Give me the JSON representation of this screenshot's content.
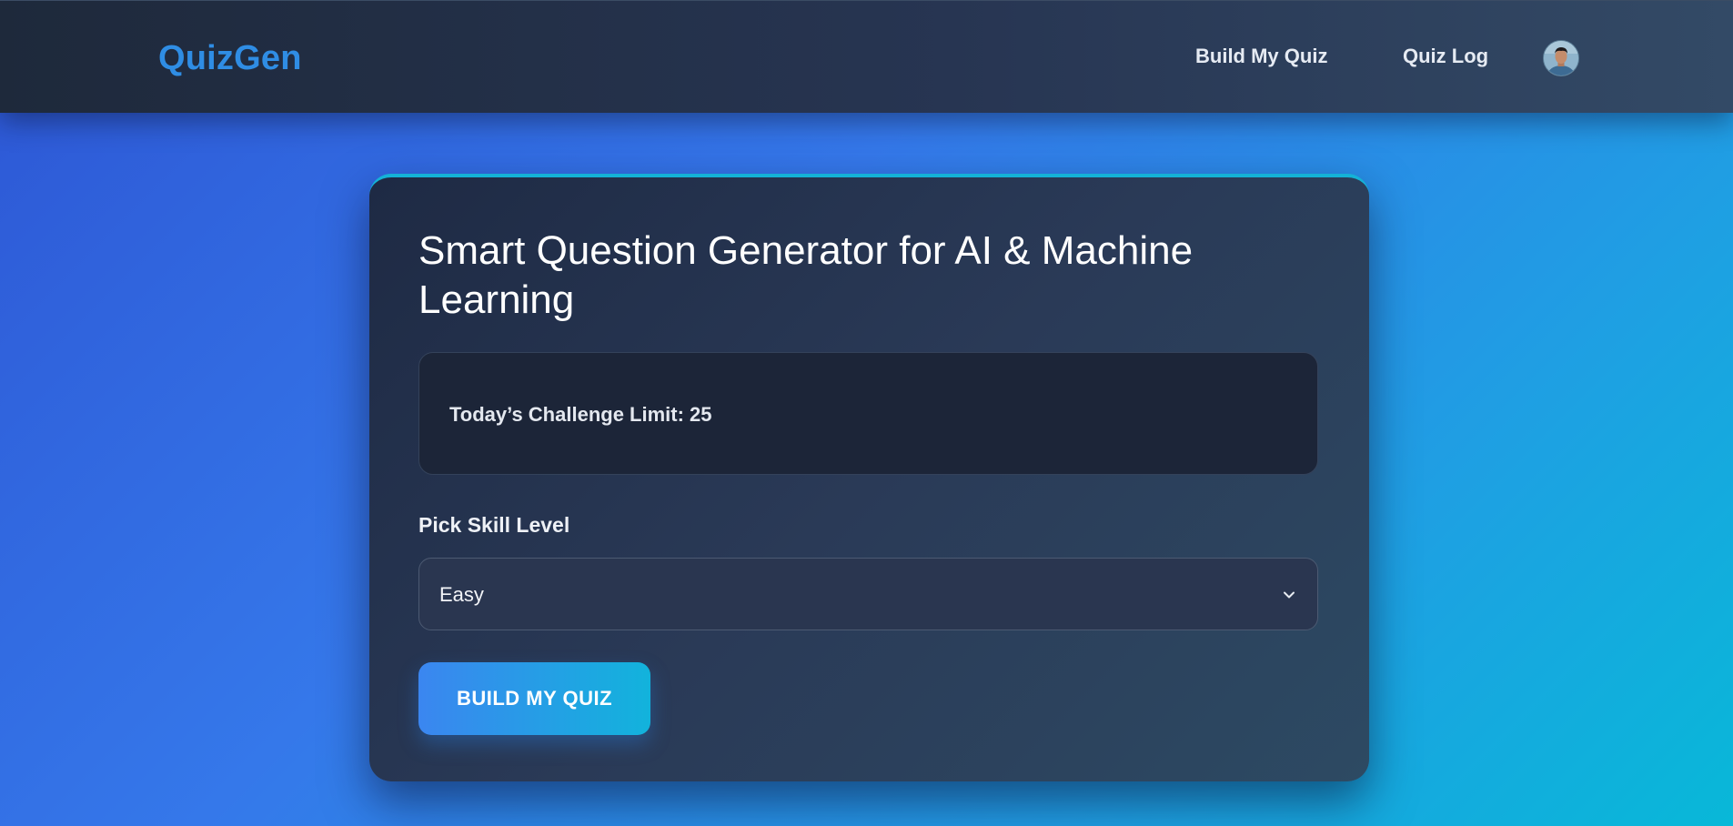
{
  "nav": {
    "brand": "QuizGen",
    "links": [
      {
        "label": "Build My Quiz"
      },
      {
        "label": "Quiz Log"
      }
    ],
    "avatar_icon": "user-avatar-icon"
  },
  "card": {
    "title": "Smart Question Generator for AI & Machine Learning",
    "limit_text": "Today’s Challenge Limit: 25",
    "skill_label": "Pick Skill Level",
    "skill_select": {
      "selected": "Easy",
      "icon": "chevron-down-icon"
    },
    "build_button_label": "BUILD MY QUIZ"
  },
  "colors": {
    "brand": "#2f8de4",
    "accent_top_border": "#14b2d6",
    "button_gradient_start": "#3b86f0",
    "button_gradient_end": "#12b3dc"
  }
}
